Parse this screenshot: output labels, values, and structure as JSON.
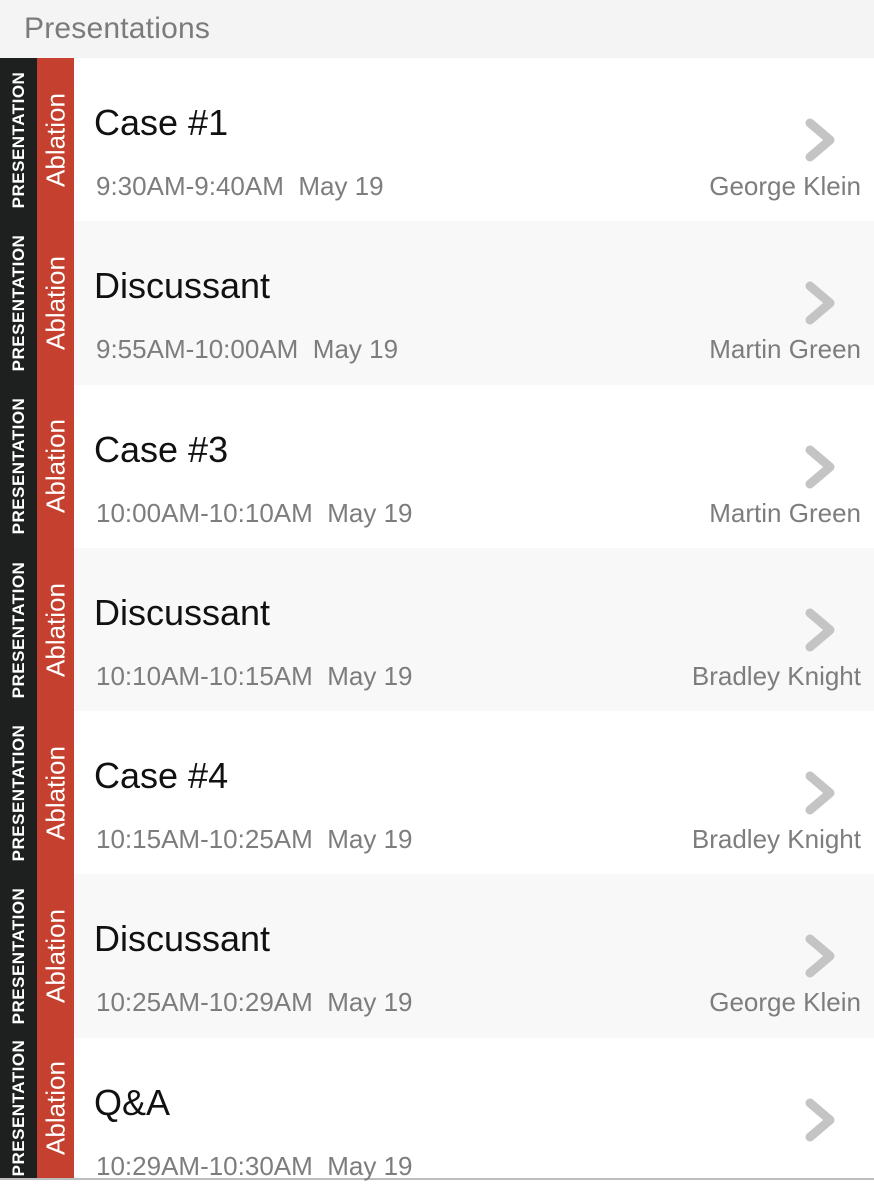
{
  "header": {
    "title": "Presentations"
  },
  "colors": {
    "type_stripe": "#1e2020",
    "track_stripe": "#c6402f",
    "chevron": "#c4c4c4"
  },
  "items": [
    {
      "type": "PRESENTATION",
      "track": "Ablation",
      "title": "Case #1",
      "time": "9:30AM-9:40AM",
      "date": "May 19",
      "speaker": "George Klein",
      "icon": "chevron-right-icon"
    },
    {
      "type": "PRESENTATION",
      "track": "Ablation",
      "title": "Discussant",
      "time": "9:55AM-10:00AM",
      "date": "May 19",
      "speaker": "Martin Green",
      "icon": "chevron-right-icon"
    },
    {
      "type": "PRESENTATION",
      "track": "Ablation",
      "title": "Case #3",
      "time": "10:00AM-10:10AM",
      "date": "May 19",
      "speaker": "Martin Green",
      "icon": "chevron-right-icon"
    },
    {
      "type": "PRESENTATION",
      "track": "Ablation",
      "title": "Discussant",
      "time": "10:10AM-10:15AM",
      "date": "May 19",
      "speaker": "Bradley Knight",
      "icon": "chevron-right-icon"
    },
    {
      "type": "PRESENTATION",
      "track": "Ablation",
      "title": "Case #4",
      "time": "10:15AM-10:25AM",
      "date": "May 19",
      "speaker": "Bradley Knight",
      "icon": "chevron-right-icon"
    },
    {
      "type": "PRESENTATION",
      "track": "Ablation",
      "title": "Discussant",
      "time": "10:25AM-10:29AM",
      "date": "May 19",
      "speaker": "George Klein",
      "icon": "chevron-right-icon"
    },
    {
      "type": "PRESENTATION",
      "track": "Ablation",
      "title": "Q&A",
      "time": "10:29AM-10:30AM",
      "date": "May 19",
      "speaker": "",
      "icon": "chevron-right-icon"
    }
  ]
}
